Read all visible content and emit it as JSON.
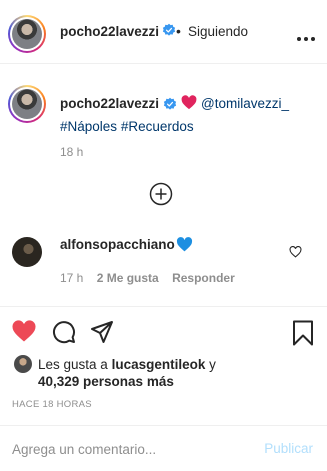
{
  "header": {
    "username": "pocho22lavezzi",
    "dot": "•",
    "follow_status": "Siguiendo",
    "more_icon": "more-horizontal-icon"
  },
  "caption": {
    "username": "pocho22lavezzi",
    "mention": "@tomilavezzi_",
    "hashtags": [
      "#Nápoles",
      "#Recuerdos"
    ],
    "emoji": "red-heart",
    "time": "18 h"
  },
  "load_more": {
    "icon": "plus-circle-icon"
  },
  "comments": [
    {
      "username": "alfonsopacchiano",
      "emoji": "blue-heart",
      "time": "17 h",
      "likes": "2 Me gusta",
      "reply": "Responder"
    }
  ],
  "actions": {
    "like": "heart-filled-icon",
    "comment": "comment-icon",
    "share": "share-icon",
    "save": "bookmark-icon",
    "like_color": "#ed4956"
  },
  "likes": {
    "prefix": "Les gusta a",
    "user": "lucasgentileok",
    "conj": "y",
    "others": "40,329 personas más"
  },
  "timestamp": "HACE 18 HORAS",
  "comment_box": {
    "placeholder": "Agrega un comentario...",
    "post_label": "Publicar"
  },
  "colors": {
    "verified": "#3897f0",
    "link": "#00376b",
    "muted": "#8e8e8e",
    "post_disabled": "#b2dffc"
  }
}
